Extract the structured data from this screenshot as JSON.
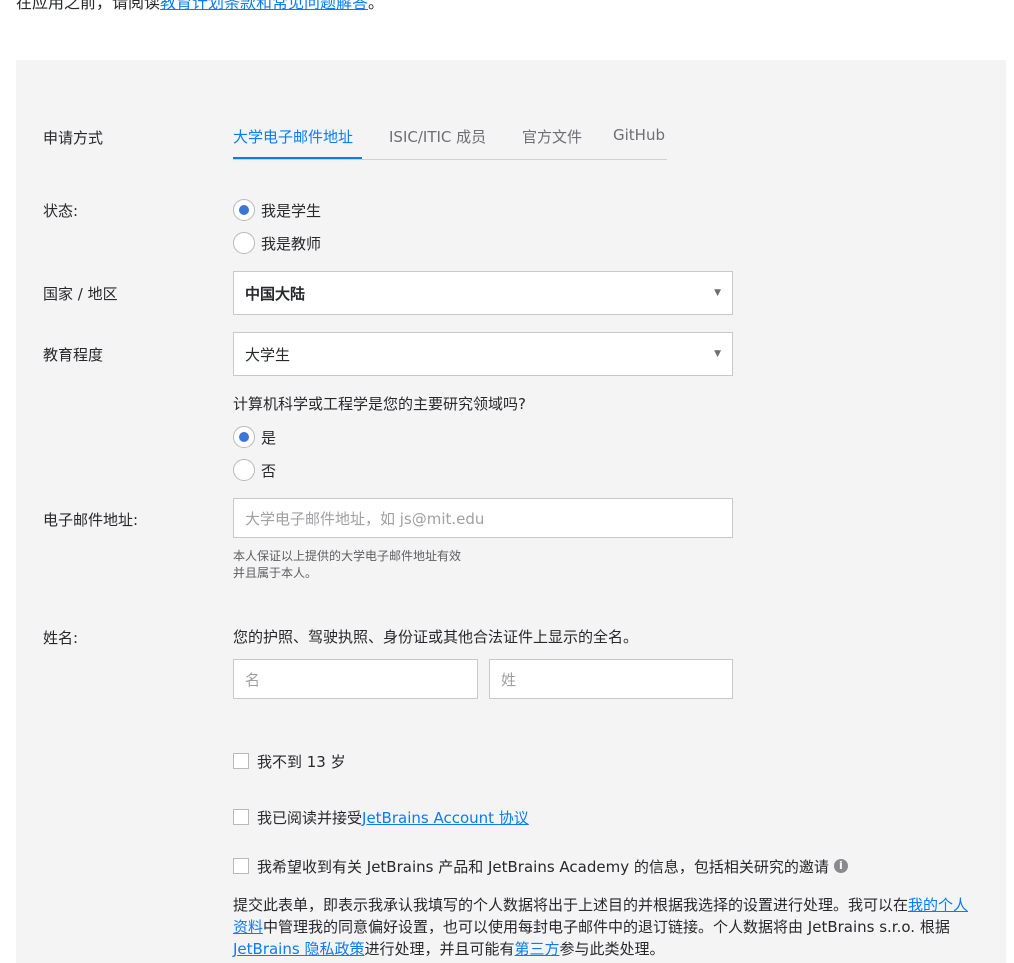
{
  "intro": {
    "prefix": "在应用之前，请阅读",
    "link": "教育计划条款和常见问题解答",
    "suffix": "。"
  },
  "form": {
    "method_label": "申请方式",
    "tabs": [
      "大学电子邮件地址",
      "ISIC/ITIC 成员",
      "官方文件",
      "GitHub"
    ],
    "active_tab": "大学电子邮件地址",
    "status_label": "状态:",
    "status_options": [
      "我是学生",
      "我是教师"
    ],
    "status_selected": "我是学生",
    "country_label": "国家 / 地区",
    "country_value": "中国大陆",
    "education_label": "教育程度",
    "education_value": "大学生",
    "cs_question": "计算机科学或工程学是您的主要研究领域吗?",
    "cs_options": [
      "是",
      "否"
    ],
    "cs_selected": "是",
    "email_label": "电子邮件地址:",
    "email_placeholder": "大学电子邮件地址，如 js@mit.edu",
    "email_hint_line1": "本人保证以上提供的大学电子邮件地址有效",
    "email_hint_line2": "并且属于本人。",
    "name_label": "姓名:",
    "name_note": "您的护照、驾驶执照、身份证或其他合法证件上显示的全名。",
    "first_name_placeholder": "名",
    "last_name_placeholder": "姓",
    "under13": "我不到 13 岁",
    "agreement_prefix": "我已阅读并接受 ",
    "agreement_link": "JetBrains Account 协议",
    "marketing": "我希望收到有关 JetBrains 产品和 JetBrains Academy 的信息，包括相关研究的邀请",
    "info_icon_glyph": "i",
    "consent_text_1": "提交此表单，即表示我承认我填写的个人数据将出于上述目的并根据我选择的设置进行处理。我可以在",
    "consent_link_profile": "我的个人资料",
    "consent_text_2": "中管理我的同意偏好设置，也可以使用每封电子邮件中的退订链接。个人数据将由 JetBrains s.r.o. 根据 ",
    "consent_link_privacy": "JetBrains 隐私政策",
    "consent_text_3": "进行处理，并且可能有",
    "consent_link_third": "第三方",
    "consent_text_4": "参与此类处理。"
  },
  "colors": {
    "accent": "#087cfa",
    "panel_bg": "#f4f4f4",
    "radio_dot": "#3b75d6"
  }
}
